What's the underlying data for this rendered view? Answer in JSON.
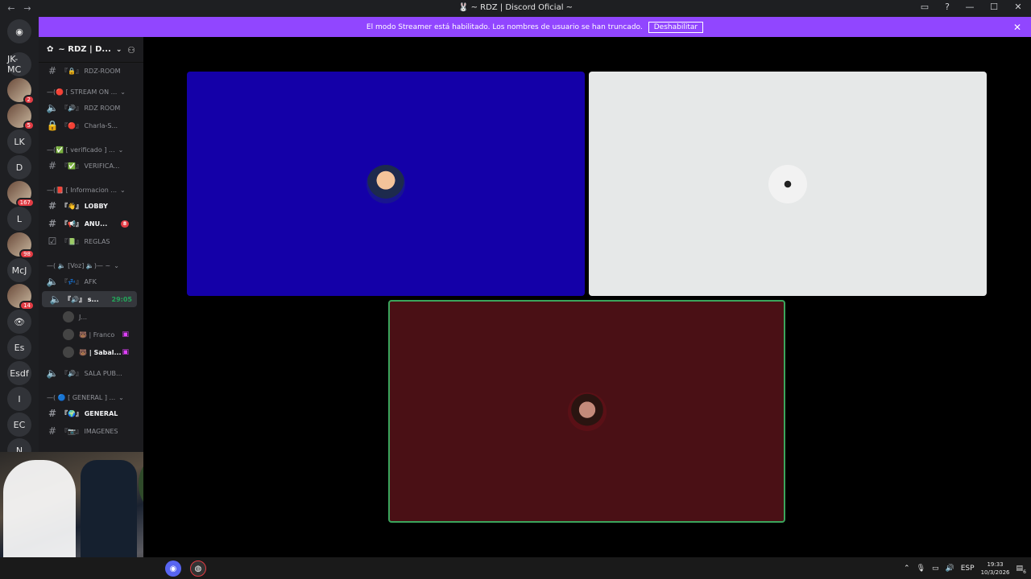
{
  "window": {
    "title": "~ RDZ | Discord Oficial ~",
    "back_icon": "arrow-left-icon",
    "forward_icon": "arrow-right-icon"
  },
  "banner": {
    "message": "El modo Streamer está habilitado. Los nombres de usuario se han truncado.",
    "button_label": "Deshabilitar",
    "color": "#9146ff"
  },
  "guilds": [
    {
      "label": "JK-MC"
    },
    {
      "label": "",
      "badge": "2"
    },
    {
      "label": "",
      "badge": "5"
    },
    {
      "label": "LK"
    },
    {
      "label": "D"
    },
    {
      "label": "",
      "badge": "167"
    },
    {
      "label": "L"
    },
    {
      "label": "",
      "badge": "98"
    },
    {
      "label": "McJ"
    },
    {
      "label": "",
      "badge": "14"
    },
    {
      "label": "👁"
    },
    {
      "label": "Es"
    },
    {
      "label": "Esdf"
    },
    {
      "label": "I"
    },
    {
      "label": "EC"
    },
    {
      "label": "N"
    }
  ],
  "server": {
    "name": "~ RDZ | D...",
    "channels": [
      {
        "kind": "text",
        "label": "『🔒』 RDZ-ROOM"
      },
      {
        "kind": "category",
        "label": "—(🔴 [ STREAM ON ..."
      },
      {
        "kind": "voice",
        "label": "『🔊』 RDZ ROOM"
      },
      {
        "kind": "locked",
        "label": "『🔴』 Charla-S..."
      },
      {
        "kind": "category",
        "label": "—(✅ [ verificado ] ..."
      },
      {
        "kind": "text",
        "label": "『✅』 VERIFICA..."
      },
      {
        "kind": "category",
        "label": "—(📕 [ Informacion ..."
      },
      {
        "kind": "text-bold",
        "label": "『👋』 LOBBY"
      },
      {
        "kind": "text-bold",
        "label": "『📢』 ANU...",
        "mention": "8"
      },
      {
        "kind": "rules",
        "label": "『📗』 REGLAS"
      },
      {
        "kind": "category",
        "label": "—( 🔈 [Voz] 🔈)— ~"
      },
      {
        "kind": "voice",
        "label": "『💤』 AFK"
      },
      {
        "kind": "voice-active",
        "label": "『🔊』 s...",
        "time": "29:05"
      },
      {
        "kind": "user",
        "label": "J..."
      },
      {
        "kind": "user",
        "label": "🐻 | Franco",
        "live": true
      },
      {
        "kind": "user-bold",
        "label": "🐻 | Sabal...",
        "live": true
      },
      {
        "kind": "voice",
        "label": "『🔊』 SALA PUB..."
      },
      {
        "kind": "category",
        "label": "—( 🔵 [ GENERAL ] ..."
      },
      {
        "kind": "text-bold",
        "label": "『🌍』 GENERAL"
      },
      {
        "kind": "text",
        "label": "『📷』 IMAGENES"
      }
    ]
  },
  "stage": {
    "tiles": [
      {
        "name": "participant-1",
        "bg": "#1400a8"
      },
      {
        "name": "participant-2",
        "bg": "#e6e8e8"
      },
      {
        "name": "participant-3",
        "bg": "#4a1015",
        "speaking": true
      }
    ]
  },
  "taskbar": {
    "language": "ESP",
    "time": "19:33",
    "date": "10/3/2026",
    "notifications": "6"
  }
}
